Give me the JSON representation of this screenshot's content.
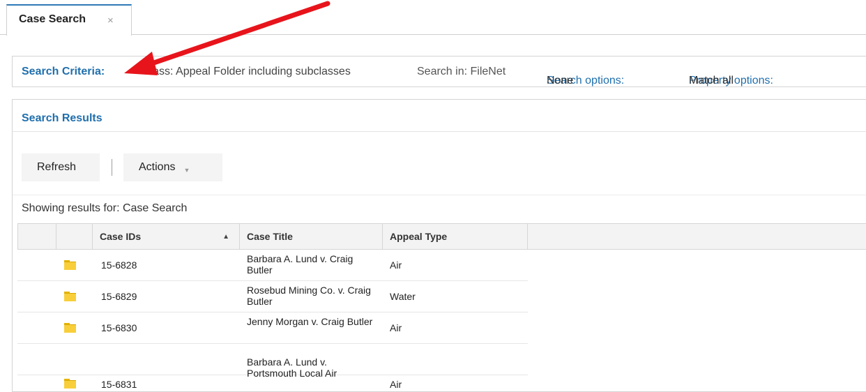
{
  "tab": {
    "label": "Case Search",
    "close": "×"
  },
  "criteria": {
    "title": "Search Criteria:",
    "class": "Class: Appeal Folder including subclasses",
    "search_in": "Search in: FileNet",
    "search_options_label": "Search options:",
    "search_options_value": "None",
    "property_options_label": "Property options:",
    "property_options_value": "Match all"
  },
  "results": {
    "title": "Search Results",
    "refresh_label": "Refresh",
    "actions_label": "Actions",
    "showing": "Showing results for: Case Search"
  },
  "grid": {
    "columns": [
      "Case IDs",
      "Case Title",
      "Appeal Type"
    ],
    "sort_indicator": "▲",
    "rows": [
      {
        "id": "15-6828",
        "title": "Barbara A. Lund v. Craig Butler",
        "type": "Air"
      },
      {
        "id": "15-6829",
        "title": "Rosebud Mining Co. v. Craig Butler",
        "type": "Water"
      },
      {
        "id": "15-6830",
        "title": "Jenny Morgan v. Craig Butler",
        "type": "Air"
      },
      {
        "id": "15-6831",
        "title": "Barbara A. Lund v. Portsmouth Local Air",
        "type": "Air"
      }
    ]
  },
  "colors": {
    "accent": "#1f6fad",
    "annotation_arrow": "#e8141b",
    "folder": "#f8cf3a"
  },
  "icons": {
    "tab_close": "close-icon",
    "actions_dropdown": "chevron-down-icon",
    "row_item": "folder-icon",
    "sort": "sort-ascending-icon"
  }
}
